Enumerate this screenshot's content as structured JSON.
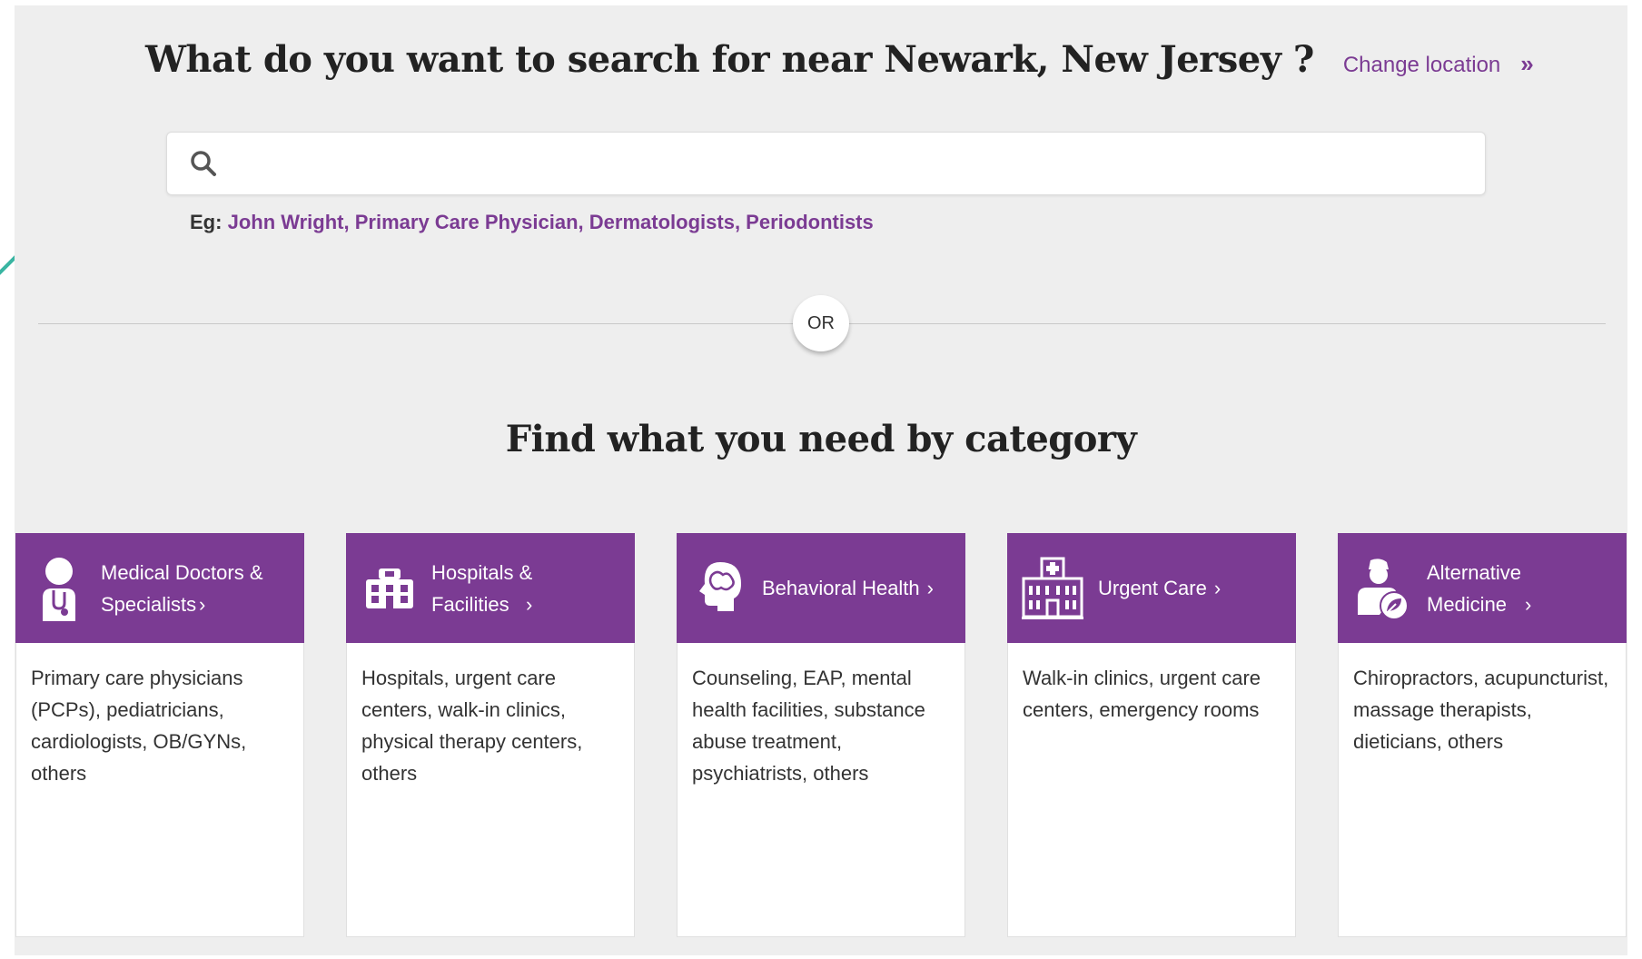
{
  "header": {
    "title": "What do you want to search for near Newark, New Jersey ?",
    "change_location_label": "Change location",
    "change_location_chevron": "»"
  },
  "search": {
    "value": "",
    "placeholder": "",
    "icon": "search-icon"
  },
  "examples": {
    "label": "Eg:",
    "items": [
      "John Wright",
      "Primary Care Physician",
      "Dermatologists",
      "Periodontists"
    ]
  },
  "divider": {
    "or_label": "OR"
  },
  "categories": {
    "heading": "Find what you need by category",
    "items": [
      {
        "title": "Medical Doctors & Specialists",
        "icon": "doctor-icon",
        "description": "Primary care physicians (PCPs), pediatricians, cardiologists, OB/GYNs, others"
      },
      {
        "title": "Hospitals & Facilities",
        "icon": "hospital-building-icon",
        "description": "Hospitals, urgent care centers, walk-in clinics, physical therapy centers, others"
      },
      {
        "title": "Behavioral Health",
        "icon": "brain-head-icon",
        "description": "Counseling, EAP, mental health facilities, substance abuse treatment, psychiatrists, others"
      },
      {
        "title": "Urgent Care",
        "icon": "urgent-care-building-icon",
        "description": "Walk-in clinics, urgent care centers, emergency rooms"
      },
      {
        "title": "Alternative Medicine",
        "icon": "alternative-medicine-icon",
        "description": "Chiropractors, acupuncturist, massage therapists, dieticians, others"
      }
    ],
    "chevron": "›"
  },
  "colors": {
    "accent": "#7b3b93",
    "panel_bg": "#eeeeee",
    "heading_text": "#222222",
    "teal_accent": "#39b5a2"
  }
}
